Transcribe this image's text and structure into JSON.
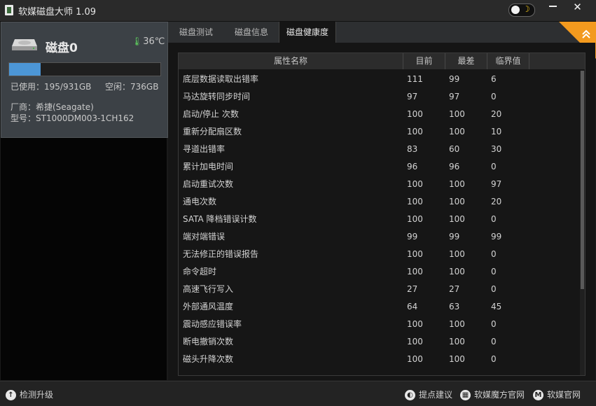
{
  "window": {
    "title": "软媒磁盘大师 1.09",
    "minimize_label": "—",
    "close_label": "✕"
  },
  "disk": {
    "name": "磁盘0",
    "temperature": "36℃",
    "usage_fraction": 0.209,
    "used_label": "已使用：195/931GB",
    "free_label": "空闲：736GB",
    "vendor_label": "厂商：希捷(Seagate)",
    "model_label": "型号：ST1000DM003-1CH162"
  },
  "tabs": [
    {
      "label": "磁盘测试"
    },
    {
      "label": "磁盘信息"
    },
    {
      "label": "磁盘健康度",
      "active": true
    }
  ],
  "table": {
    "headers": [
      "属性名称",
      "目前",
      "最差",
      "临界值"
    ],
    "rows": [
      [
        "底层数据读取出错率",
        "111",
        "99",
        "6"
      ],
      [
        "马达旋转同步时间",
        "97",
        "97",
        "0"
      ],
      [
        "启动/停止 次数",
        "100",
        "100",
        "20"
      ],
      [
        "重新分配扇区数",
        "100",
        "100",
        "10"
      ],
      [
        "寻道出错率",
        "83",
        "60",
        "30"
      ],
      [
        "累计加电时间",
        "96",
        "96",
        "0"
      ],
      [
        "启动重试次数",
        "100",
        "100",
        "97"
      ],
      [
        "通电次数",
        "100",
        "100",
        "20"
      ],
      [
        "SATA 降档错误计数",
        "100",
        "100",
        "0"
      ],
      [
        "端对端错误",
        "99",
        "99",
        "99"
      ],
      [
        "无法修正的错误报告",
        "100",
        "100",
        "0"
      ],
      [
        "命令超时",
        "100",
        "100",
        "0"
      ],
      [
        "高速飞行写入",
        "27",
        "27",
        "0"
      ],
      [
        "外部通风温度",
        "64",
        "63",
        "45"
      ],
      [
        "震动感应错误率",
        "100",
        "100",
        "0"
      ],
      [
        "断电撤销次数",
        "100",
        "100",
        "0"
      ],
      [
        "磁头升降次数",
        "100",
        "100",
        "0"
      ]
    ]
  },
  "bottom": {
    "update_label": "检测升级",
    "feedback_label": "提点建议",
    "mofang_label": "软媒魔方官网",
    "ruanmei_label": "软媒官网"
  },
  "colors": {
    "accent_orange": "#f39a1e",
    "usage_blue": "#4c96d6",
    "temp_green": "#5fd25f"
  }
}
